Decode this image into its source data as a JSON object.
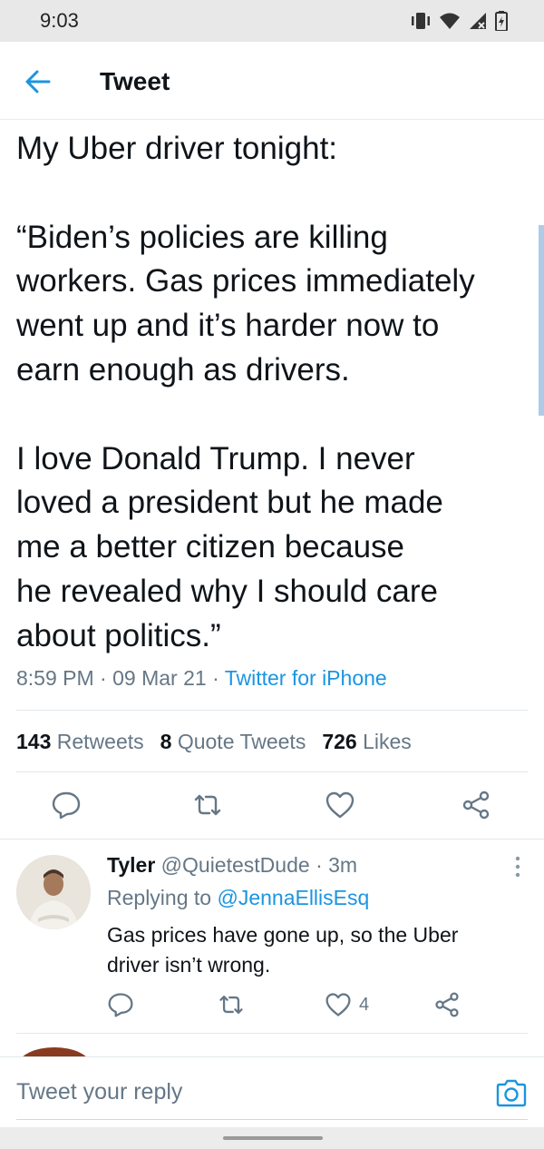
{
  "status_bar": {
    "time": "9:03",
    "icons": [
      "vibrate-icon",
      "wifi-icon",
      "cell-signal-icon",
      "battery-icon"
    ]
  },
  "header": {
    "back_icon": "back-arrow-icon",
    "title": "Tweet"
  },
  "tweet": {
    "text": "My Uber driver tonight:\n\n“Biden’s policies are killing\nworkers. Gas prices immediately\nwent up and it’s harder now to\nearn enough as drivers.\n\nI love Donald Trump. I never\nloved a president but he made\nme a better citizen because\nhe revealed why I should care\nabout politics.”",
    "time": "8:59 PM",
    "date": "09 Mar 21",
    "source": "Twitter for iPhone",
    "sep": "·"
  },
  "stats": {
    "retweets_count": "143",
    "retweets_label": "Retweets",
    "quotes_count": "8",
    "quotes_label": "Quote Tweets",
    "likes_count": "726",
    "likes_label": "Likes"
  },
  "actions": [
    "reply-icon",
    "retweet-icon",
    "like-icon",
    "share-icon"
  ],
  "reply": {
    "name": "Tyler",
    "handle": "@QuietestDude",
    "sep": "·",
    "age": "3m",
    "replying_prefix": "Replying to",
    "replying_to": "@JennaEllisEsq",
    "text": "Gas prices have gone up, so the Uber driver isn’t wrong.",
    "like_count": "4"
  },
  "compose": {
    "placeholder": "Tweet your reply"
  },
  "colors": {
    "accent": "#1b95e0",
    "text": "#0f1419",
    "secondary": "#657786",
    "divider": "#e1e8ed"
  }
}
